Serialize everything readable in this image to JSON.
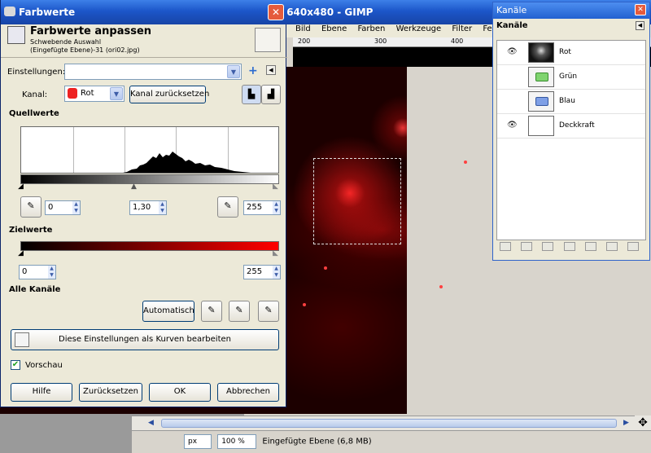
{
  "gimp_window": {
    "title": "n) 640x480 - GIMP",
    "menu": [
      "Bild",
      "Ebene",
      "Farben",
      "Werkzeuge",
      "Filter",
      "Fenste"
    ],
    "ruler_ticks": [
      "200",
      "300",
      "400"
    ],
    "status": {
      "unit": "px",
      "zoom": "100 %",
      "text": "Eingefügte Ebene (6,8 MB)"
    }
  },
  "channels_dock": {
    "title": "Kanäle",
    "tab_label": "Kanäle",
    "channels": [
      {
        "name": "Rot",
        "visible": true
      },
      {
        "name": "Grün",
        "visible": false
      },
      {
        "name": "Blau",
        "visible": false
      },
      {
        "name": "Deckkraft",
        "visible": true
      }
    ]
  },
  "levels_dialog": {
    "title": "Farbwerte",
    "header_title": "Farbwerte anpassen",
    "header_sub1": "Schwebende Auswahl",
    "header_sub2": "(Eingefügte Ebene)-31 (ori02.jpg)",
    "presets_label": "Einstellungen:",
    "presets_value": "",
    "channel_label": "Kanal:",
    "channel_value": "Rot",
    "reset_channel_button": "Kanal zurücksetzen",
    "input_section": "Quellwerte",
    "input_low": "0",
    "input_gamma": "1,30",
    "input_high": "255",
    "output_section": "Zielwerte",
    "output_low": "0",
    "output_high": "255",
    "all_channels_section": "Alle Kanäle",
    "auto_button": "Automatisch",
    "curves_button": "Diese Einstellungen als Kurven bearbeiten",
    "preview_label": "Vorschau",
    "preview_checked": true,
    "help_button": "Hilfe",
    "reset_button": "Zurücksetzen",
    "ok_button": "OK",
    "cancel_button": "Abbrechen"
  },
  "colors": {
    "titlebar": "#1c56c9",
    "output_gradient_end": "#ff0000"
  }
}
